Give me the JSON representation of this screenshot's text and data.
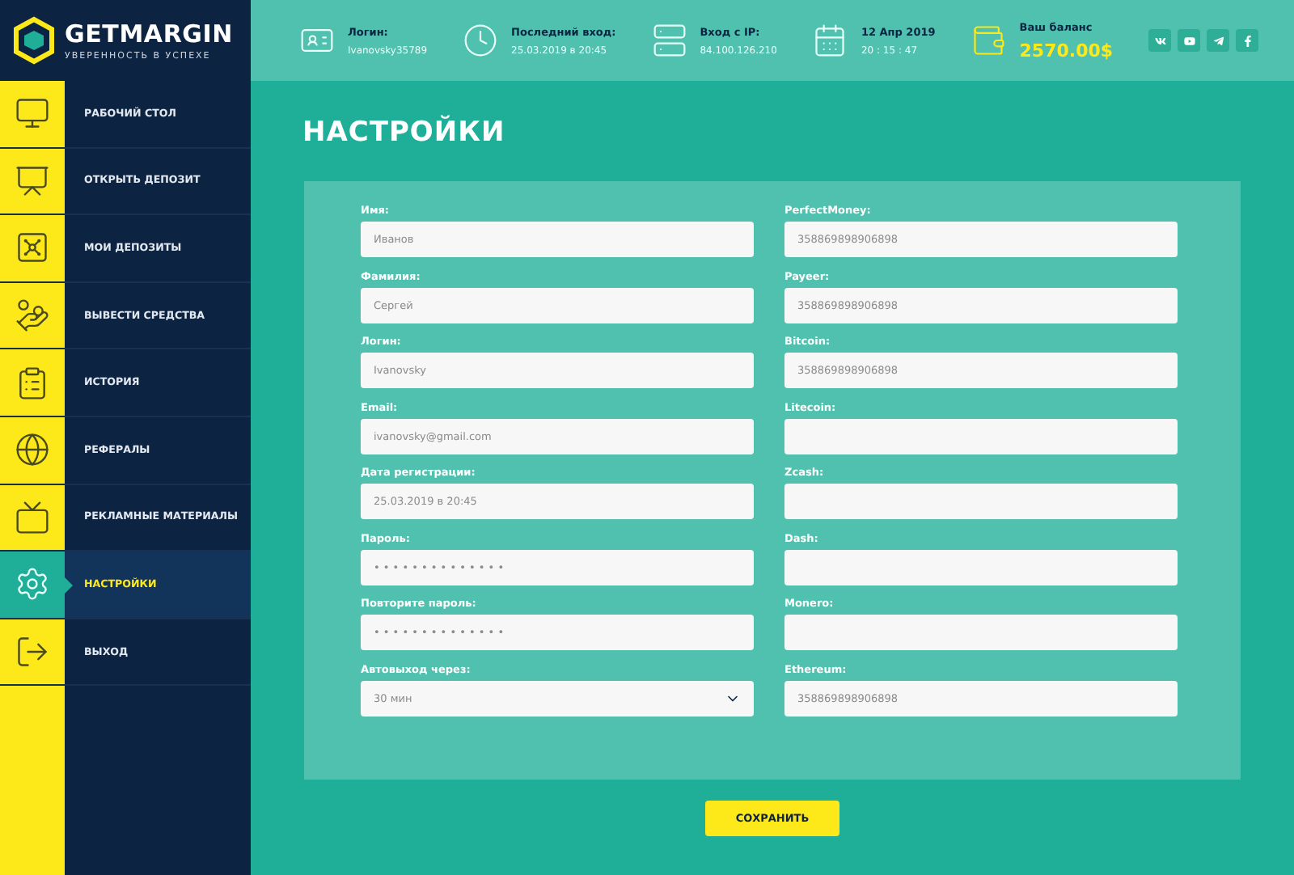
{
  "logo": {
    "name": "GETMARGIN",
    "tagline": "УВЕРЕННОСТЬ В УСПЕХЕ"
  },
  "header": {
    "stats": [
      {
        "kind": "info",
        "label": "Логин:",
        "value": "Ivanovsky35789"
      },
      {
        "kind": "info",
        "label": "Последний вход:",
        "value": "25.03.2019 в 20:45"
      },
      {
        "kind": "info",
        "label": "Вход с IP:",
        "value": "84.100.126.210"
      },
      {
        "kind": "info",
        "label": "12 Апр 2019",
        "value": "20 : 15 : 47"
      },
      {
        "kind": "balance",
        "label": "Ваш баланс",
        "value": "2570.00$"
      }
    ]
  },
  "sidebar": {
    "items": [
      {
        "label": "РАБОЧИЙ СТОЛ",
        "selected": false
      },
      {
        "label": "ОТКРЫТЬ ДЕПОЗИТ",
        "selected": false
      },
      {
        "label": "МОИ ДЕПОЗИТЫ",
        "selected": false
      },
      {
        "label": "ВЫВЕСТИ СРЕДСТВА",
        "selected": false
      },
      {
        "label": "ИСТОРИЯ",
        "selected": false
      },
      {
        "label": "РЕФЕРАЛЫ",
        "selected": false
      },
      {
        "label": "РЕКЛАМНЫЕ МАТЕРИАЛЫ",
        "selected": false
      },
      {
        "label": "НАСТРОЙКИ",
        "selected": true
      },
      {
        "label": "ВЫХОД",
        "selected": false
      }
    ]
  },
  "page_title": "НАСТРОЙКИ",
  "form": {
    "left": [
      {
        "kind": "text",
        "label": "Имя:",
        "value": "Иванов"
      },
      {
        "kind": "text",
        "label": "Фамилия:",
        "value": "Сергей"
      },
      {
        "kind": "text",
        "label": "Логин:",
        "value": "Ivanovsky"
      },
      {
        "kind": "text",
        "label": "Email:",
        "value": "ivanovsky@gmail.com"
      },
      {
        "kind": "text",
        "label": "Дата регистрации:",
        "value": "25.03.2019 в 20:45"
      },
      {
        "kind": "text",
        "label": "Пароль:",
        "value": "• • • • • • • • • • • • • •"
      },
      {
        "kind": "text",
        "label": "Повторите пароль:",
        "value": "• • • • • • • • • • • • • •"
      },
      {
        "kind": "select",
        "label": "Автовыход через:",
        "value": "30 мин"
      }
    ],
    "right": [
      {
        "kind": "text",
        "label": "PerfectMoney:",
        "value": "358869898906898"
      },
      {
        "kind": "text",
        "label": "Payeer:",
        "value": "358869898906898"
      },
      {
        "kind": "text",
        "label": "Bitcoin:",
        "value": "358869898906898"
      },
      {
        "kind": "text",
        "label": "Litecoin:"
      },
      {
        "kind": "text",
        "label": "Zcash:"
      },
      {
        "kind": "text",
        "label": "Dash:"
      },
      {
        "kind": "text",
        "label": "Monero:"
      },
      {
        "kind": "text",
        "label": "Ethereum:",
        "value": "358869898906898"
      }
    ],
    "save_button": "СОХРАНИТЬ"
  }
}
